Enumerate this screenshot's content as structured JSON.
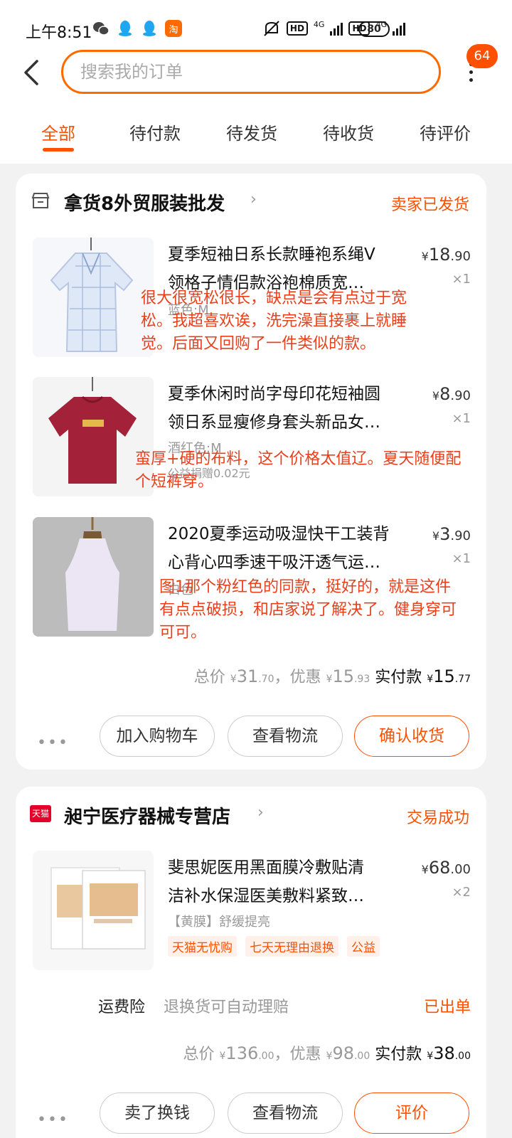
{
  "status_bar": {
    "time": "上午8:51",
    "network_1": "4G",
    "network_2": "4G",
    "hd_1": "HD",
    "hd_2": "HD",
    "battery": "80",
    "taobao_icon_text": "淘"
  },
  "header": {
    "search_placeholder": "搜索我的订单",
    "more_badge": "64"
  },
  "tabs": [
    "全部",
    "待付款",
    "待发货",
    "待收货",
    "待评价"
  ],
  "orders": [
    {
      "shop": "拿货8外贸服装批发",
      "status": "卖家已发货",
      "items": [
        {
          "title_line1": "夏季短袖日系长款睡袍系绳V",
          "title_line2": "领格子情侣款浴袍棉质宽…",
          "sku": "蓝色;M",
          "price_yuan": "18",
          "price_cents": ".90",
          "qty": "×1",
          "review": "很大很宽松很长，缺点是会有点过于宽松。我超喜欢诶，洗完澡直接裹上就睡觉。后面又回购了一件类似的款。"
        },
        {
          "title_line1": "夏季休闲时尚字母印花短袖圆",
          "title_line2": "领日系显瘦修身套头新品女…",
          "sku": "酒红色;M",
          "note": "公益捐赠0.02元",
          "price_yuan": "8",
          "price_cents": ".90",
          "qty": "×1",
          "review": "蛮厚+硬的布料，这个价格太值辽。夏天随便配个短裤穿。"
        },
        {
          "title_line1": "2020夏季运动吸湿快干工装背",
          "title_line2": "心背心四季速干吸汗透气运…",
          "sku": "白色",
          "price_yuan": "3",
          "price_cents": ".90",
          "qty": "×1",
          "review": "图1那个粉红色的同款，挺好的，就是这件有点点破损，和店家说了解决了。健身穿可可可。"
        }
      ],
      "summary": {
        "total_label": "总价",
        "total_yuan": "31",
        "total_cents": ".70",
        "discount_label": "，优惠",
        "discount_yuan": "15",
        "discount_cents": ".93",
        "paid_label": "实付款",
        "paid_yuan": "15",
        "paid_cents": ".77",
        "currency": "¥"
      },
      "actions": [
        "加入购物车",
        "查看物流",
        "确认收货"
      ],
      "more_dots": "•••"
    },
    {
      "shop": "昶宁医疗器械专营店",
      "shop_badge": "天猫",
      "status": "交易成功",
      "items": [
        {
          "title_line1": "斐思妮医用黑面膜冷敷贴清",
          "title_line2": "洁补水保湿医美敷料紧致…",
          "sku": "【黄膜】舒缓提亮",
          "price_yuan": "68",
          "price_cents": ".00",
          "qty": "×2",
          "tags": [
            "天猫无忧购",
            "七天无理由退换",
            "公益"
          ]
        }
      ],
      "insurance": {
        "label": "运费险",
        "desc": "退换货可自动理赔",
        "status": "已出单"
      },
      "summary": {
        "total_label": "总价",
        "total_yuan": "136",
        "total_cents": ".00",
        "discount_label": "，优惠",
        "discount_yuan": "98",
        "discount_cents": ".00",
        "paid_label": "实付款",
        "paid_yuan": "38",
        "paid_cents": ".00",
        "currency": "¥"
      },
      "actions": [
        "卖了换钱",
        "查看物流",
        "评价"
      ],
      "more_dots": "•••"
    }
  ],
  "colors": {
    "accent": "#ff5000",
    "review_text": "#e8401c",
    "background": "#f2f2f2"
  }
}
